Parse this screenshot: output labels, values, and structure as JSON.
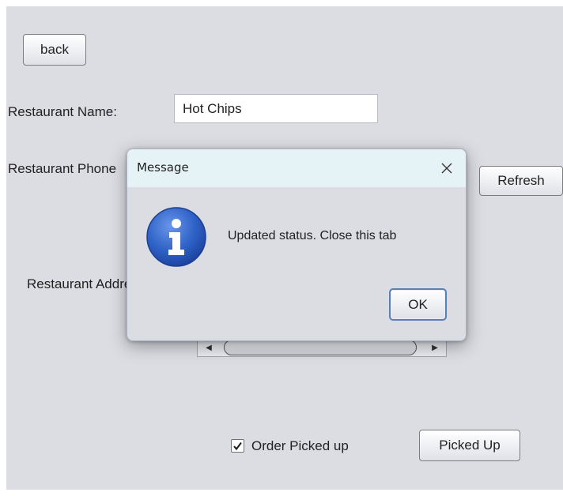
{
  "form": {
    "back_label": "back",
    "restaurant_name_label": "Restaurant Name:",
    "restaurant_name_value": "Hot Chips",
    "restaurant_phone_label": "Restaurant Phone",
    "refresh_label": "Refresh",
    "restaurant_address_label": "Restaurant Address",
    "order_picked_up_label": "Order Picked up",
    "order_picked_up_checked": true,
    "picked_up_button_label": "Picked Up"
  },
  "dialog": {
    "title": "Message",
    "message": "Updated status. Close this tab",
    "ok_label": "OK",
    "icon": "info-icon",
    "close_icon": "close-icon"
  },
  "colors": {
    "panel_bg": "#dcdde3",
    "dialog_titlebar_bg": "#e5f3f7",
    "info_icon_blue": "#2f62c7",
    "ok_border": "#5a7fb6"
  }
}
